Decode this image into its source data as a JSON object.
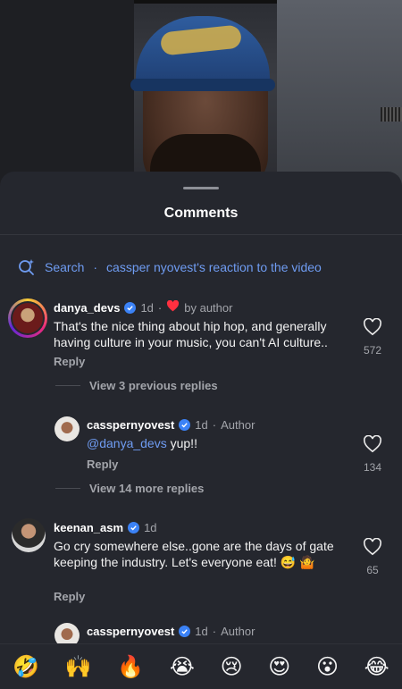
{
  "sheet": {
    "title": "Comments"
  },
  "search": {
    "prefix": "Search",
    "separator": "·",
    "query": "cassper nyovest's reaction to the video"
  },
  "comments": [
    {
      "username": "danya_devs",
      "time": "1d",
      "dot": "·",
      "liked_by": "by author",
      "text": "That's the nice thing about hip hop, and generally having culture in your music, you can't AI culture..",
      "likes": "572",
      "reply_label": "Reply",
      "view_replies": "View 3 previous replies"
    },
    {
      "username": "casspernyovest",
      "time": "1d",
      "dot": "·",
      "author_tag": "Author",
      "mention": "@danya_devs",
      "text": " yup!!",
      "likes": "134",
      "reply_label": "Reply",
      "view_replies": "View 14 more replies"
    },
    {
      "username": "keenan_asm",
      "time": "1d",
      "text": "Go cry somewhere else..gone are the days of gate keeping the industry. Let's everyone eat! 😅 🤷",
      "likes": "65",
      "reply_label": "Reply"
    },
    {
      "username": "casspernyovest",
      "time": "1d",
      "dot": "·",
      "author_tag": "Author"
    }
  ],
  "emoji_bar": [
    "🤣",
    "🙌",
    "🔥",
    "😭",
    "😢",
    "😍",
    "😮",
    "😂"
  ],
  "colors": {
    "sheet_bg": "#25272e",
    "accent_blue": "#6f9cf2",
    "verified": "#3b82f6",
    "heart_red": "#ff3040"
  }
}
